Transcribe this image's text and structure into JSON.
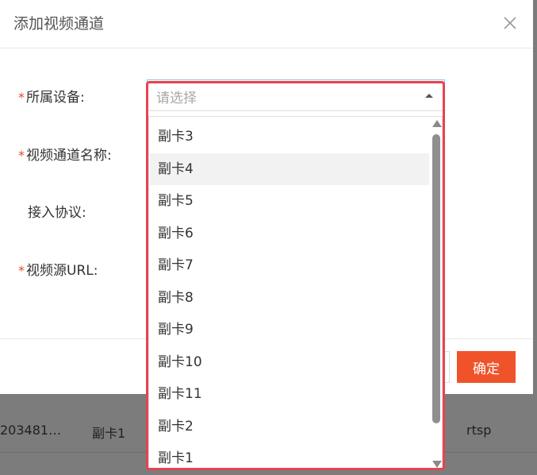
{
  "modal": {
    "title": "添加视频通道",
    "confirm_label": "确定",
    "fields": [
      {
        "label": "所属设备:",
        "required": true
      },
      {
        "label": "视频通道名称:",
        "required": true
      },
      {
        "label": "接入协议:",
        "required": false
      },
      {
        "label": "视频源URL:",
        "required": true
      }
    ],
    "required_mark": "*"
  },
  "select": {
    "placeholder": "请选择",
    "options": [
      "副卡3",
      "副卡4",
      "副卡5",
      "副卡6",
      "副卡7",
      "副卡8",
      "副卡9",
      "副卡10",
      "副卡11",
      "副卡2",
      "副卡1"
    ],
    "hovered_option": "副卡4"
  },
  "background_table": {
    "row": [
      "203481…",
      "副卡1",
      "rtsp"
    ]
  },
  "icons": {
    "close": "close-icon",
    "caret": "caret-up-icon"
  },
  "colors": {
    "accent": "#f0532a",
    "required": "#e8452c",
    "highlight": "#e8434f",
    "focus_border": "#8ec3ec"
  }
}
